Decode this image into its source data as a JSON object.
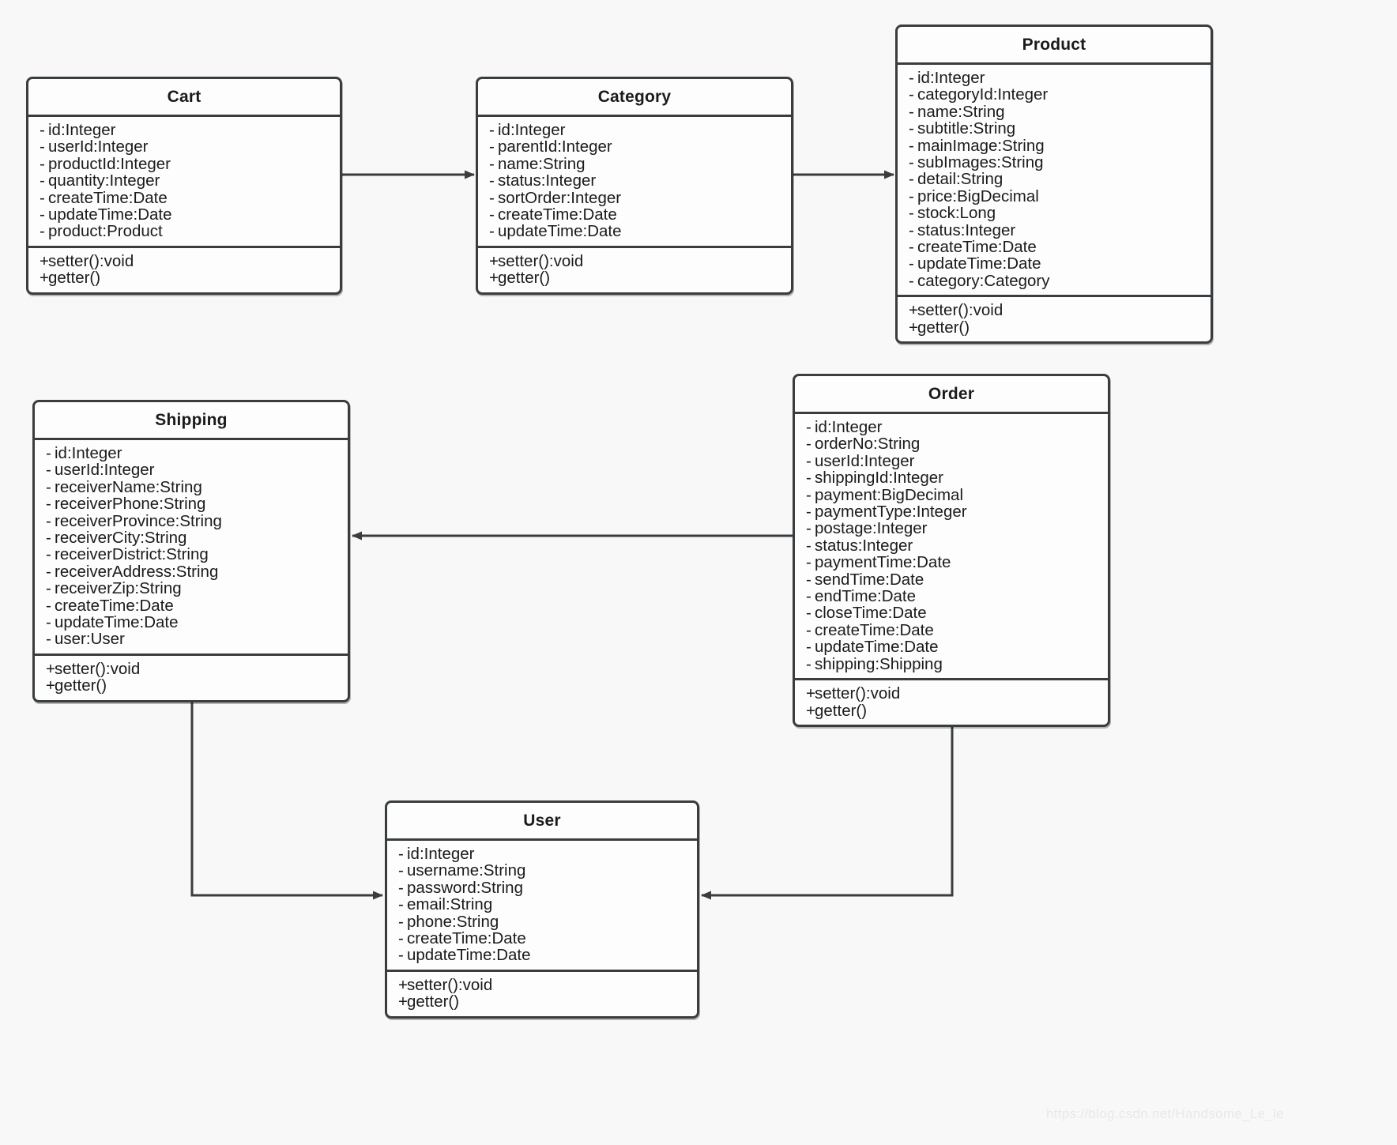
{
  "diagram": {
    "type": "uml-class-diagram",
    "watermark": "https://blog.csdn.net/Handsome_Le_le",
    "classes": [
      {
        "id": "cart",
        "name": "Cart",
        "attributes": [
          {
            "vis": "-",
            "text": "id:Integer"
          },
          {
            "vis": "-",
            "text": "userId:Integer"
          },
          {
            "vis": "-",
            "text": "productId:Integer"
          },
          {
            "vis": "-",
            "text": "quantity:Integer"
          },
          {
            "vis": "-",
            "text": "createTime:Date"
          },
          {
            "vis": "-",
            "text": "updateTime:Date"
          },
          {
            "vis": "-",
            "text": "product:Product"
          }
        ],
        "methods": [
          {
            "vis": "+",
            "text": "setter():void"
          },
          {
            "vis": "+",
            "text": "getter()"
          }
        ]
      },
      {
        "id": "category",
        "name": "Category",
        "attributes": [
          {
            "vis": "-",
            "text": "id:Integer"
          },
          {
            "vis": "-",
            "text": "parentId:Integer"
          },
          {
            "vis": "-",
            "text": "name:String"
          },
          {
            "vis": "-",
            "text": "status:Integer"
          },
          {
            "vis": "-",
            "text": "sortOrder:Integer"
          },
          {
            "vis": "-",
            "text": "createTime:Date"
          },
          {
            "vis": "-",
            "text": "updateTime:Date"
          }
        ],
        "methods": [
          {
            "vis": "+",
            "text": "setter():void"
          },
          {
            "vis": "+",
            "text": "getter()"
          }
        ]
      },
      {
        "id": "product",
        "name": "Product",
        "attributes": [
          {
            "vis": "-",
            "text": "id:Integer"
          },
          {
            "vis": "-",
            "text": "categoryId:Integer"
          },
          {
            "vis": "-",
            "text": "name:String"
          },
          {
            "vis": "-",
            "text": "subtitle:String"
          },
          {
            "vis": "-",
            "text": "mainImage:String"
          },
          {
            "vis": "-",
            "text": "subImages:String"
          },
          {
            "vis": "-",
            "text": "detail:String"
          },
          {
            "vis": "-",
            "text": "price:BigDecimal"
          },
          {
            "vis": "-",
            "text": "stock:Long"
          },
          {
            "vis": "-",
            "text": "status:Integer"
          },
          {
            "vis": "-",
            "text": "createTime:Date"
          },
          {
            "vis": "-",
            "text": "updateTime:Date"
          },
          {
            "vis": "-",
            "text": "category:Category"
          }
        ],
        "methods": [
          {
            "vis": "+",
            "text": "setter():void"
          },
          {
            "vis": "+",
            "text": "getter()"
          }
        ]
      },
      {
        "id": "shipping",
        "name": "Shipping",
        "attributes": [
          {
            "vis": "-",
            "text": "id:Integer"
          },
          {
            "vis": "-",
            "text": "userId:Integer"
          },
          {
            "vis": "-",
            "text": "receiverName:String"
          },
          {
            "vis": "-",
            "text": "receiverPhone:String"
          },
          {
            "vis": "-",
            "text": "receiverProvince:String"
          },
          {
            "vis": "-",
            "text": "receiverCity:String"
          },
          {
            "vis": "-",
            "text": "receiverDistrict:String"
          },
          {
            "vis": "-",
            "text": "receiverAddress:String"
          },
          {
            "vis": "-",
            "text": "receiverZip:String"
          },
          {
            "vis": "-",
            "text": "createTime:Date"
          },
          {
            "vis": "-",
            "text": "updateTime:Date"
          },
          {
            "vis": "-",
            "text": "user:User"
          }
        ],
        "methods": [
          {
            "vis": "+",
            "text": "setter():void"
          },
          {
            "vis": "+",
            "text": "getter()"
          }
        ]
      },
      {
        "id": "order",
        "name": "Order",
        "attributes": [
          {
            "vis": "-",
            "text": "id:Integer"
          },
          {
            "vis": "-",
            "text": "orderNo:String"
          },
          {
            "vis": "-",
            "text": "userId:Integer"
          },
          {
            "vis": "-",
            "text": "shippingId:Integer"
          },
          {
            "vis": "-",
            "text": "payment:BigDecimal"
          },
          {
            "vis": "-",
            "text": "paymentType:Integer"
          },
          {
            "vis": "-",
            "text": "postage:Integer"
          },
          {
            "vis": "-",
            "text": "status:Integer"
          },
          {
            "vis": "-",
            "text": "paymentTime:Date"
          },
          {
            "vis": "-",
            "text": "sendTime:Date"
          },
          {
            "vis": "-",
            "text": "endTime:Date"
          },
          {
            "vis": "-",
            "text": "closeTime:Date"
          },
          {
            "vis": "-",
            "text": "createTime:Date"
          },
          {
            "vis": "-",
            "text": "updateTime:Date"
          },
          {
            "vis": "-",
            "text": "shipping:Shipping"
          }
        ],
        "methods": [
          {
            "vis": "+",
            "text": "setter():void"
          },
          {
            "vis": "+",
            "text": "getter()"
          }
        ]
      },
      {
        "id": "user",
        "name": "User",
        "attributes": [
          {
            "vis": "-",
            "text": "id:Integer"
          },
          {
            "vis": "-",
            "text": "username:String"
          },
          {
            "vis": "-",
            "text": "password:String"
          },
          {
            "vis": "-",
            "text": "email:String"
          },
          {
            "vis": "-",
            "text": "phone:String"
          },
          {
            "vis": "-",
            "text": "createTime:Date"
          },
          {
            "vis": "-",
            "text": "updateTime:Date"
          }
        ],
        "methods": [
          {
            "vis": "+",
            "text": "setter():void"
          },
          {
            "vis": "+",
            "text": "getter()"
          }
        ]
      }
    ],
    "relations": [
      {
        "id": "cart-to-category",
        "from": "Cart",
        "to": "Category"
      },
      {
        "id": "category-to-product",
        "from": "Category",
        "to": "Product"
      },
      {
        "id": "order-to-shipping",
        "from": "Order",
        "to": "Shipping"
      },
      {
        "id": "shipping-to-user",
        "from": "Shipping",
        "to": "User"
      },
      {
        "id": "order-to-user",
        "from": "Order",
        "to": "User"
      }
    ]
  }
}
